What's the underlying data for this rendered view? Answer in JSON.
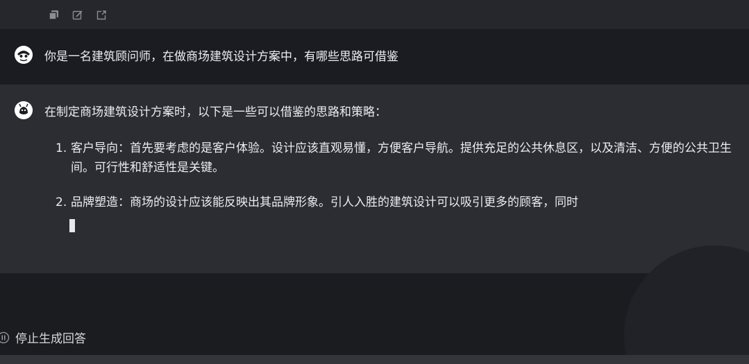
{
  "toolbar": {
    "icons": [
      "copy-icon",
      "edit-icon",
      "share-icon"
    ]
  },
  "user_message": {
    "avatar_icon": "user-avatar-icon",
    "text": "你是一名建筑顾问师，在做商场建筑设计方案中，有哪些思路可借鉴"
  },
  "assistant_message": {
    "avatar_icon": "assistant-avatar-icon",
    "intro": "在制定商场建筑设计方案时，以下是一些可以借鉴的思路和策略：",
    "items": [
      {
        "number": "1.",
        "text": "客户导向：首先要考虑的是客户体验。设计应该直观易懂，方便客户导航。提供充足的公共休息区，以及清洁、方便的公共卫生间。可行性和舒适性是关键。"
      },
      {
        "number": "2.",
        "text": "品牌塑造：商场的设计应该能反映出其品牌形象。引人入胜的建筑设计可以吸引更多的顾客，同时"
      }
    ]
  },
  "stop_button": {
    "label": "停止生成回答",
    "icon": "pause-circle-icon"
  },
  "colors": {
    "background": "#1d1f25",
    "user_row": "#1b1c21",
    "assistant_row": "#2b2d33",
    "text": "#ececf1"
  }
}
